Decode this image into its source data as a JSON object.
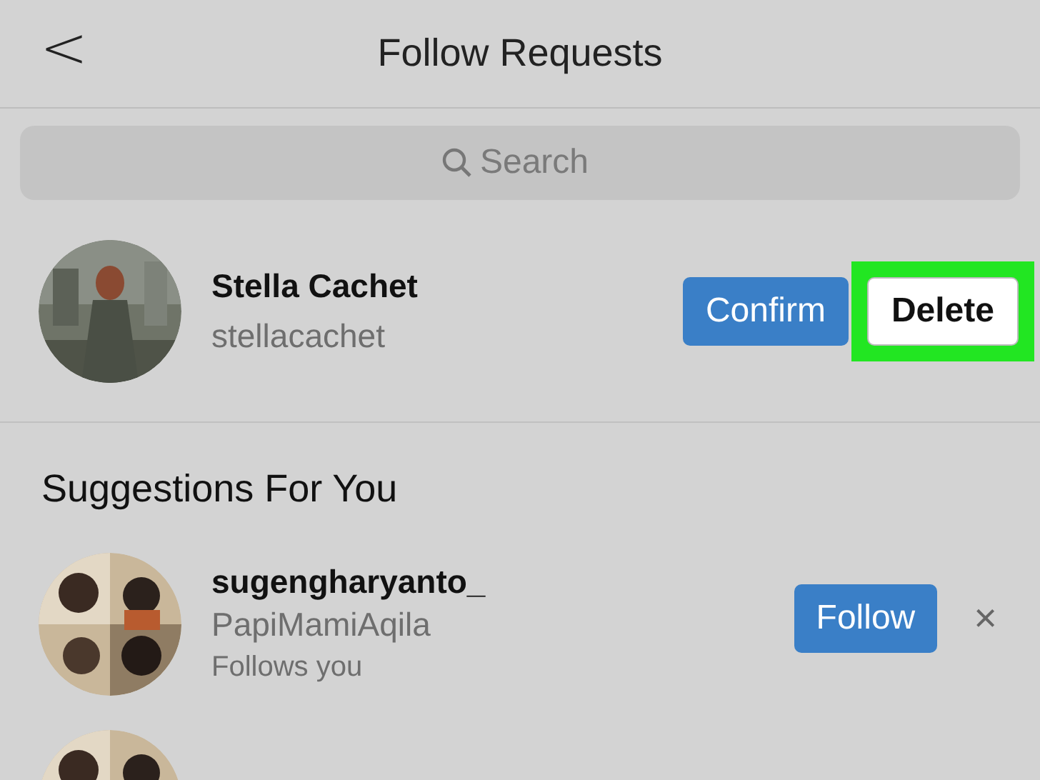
{
  "header": {
    "back": "<",
    "title": "Follow Requests"
  },
  "search": {
    "placeholder": "Search"
  },
  "requests": [
    {
      "name": "Stella Cachet",
      "username": "stellacachet",
      "confirm": "Confirm",
      "delete": "Delete",
      "delete_highlighted": true
    }
  ],
  "suggestions_heading": "Suggestions For You",
  "suggestions": [
    {
      "name": "sugengharyanto_",
      "username": "PapiMamiAqila",
      "note": "Follows you",
      "follow": "Follow",
      "dismiss": "×"
    },
    {
      "avatar": {
        "kind": "picture"
      }
    }
  ]
}
